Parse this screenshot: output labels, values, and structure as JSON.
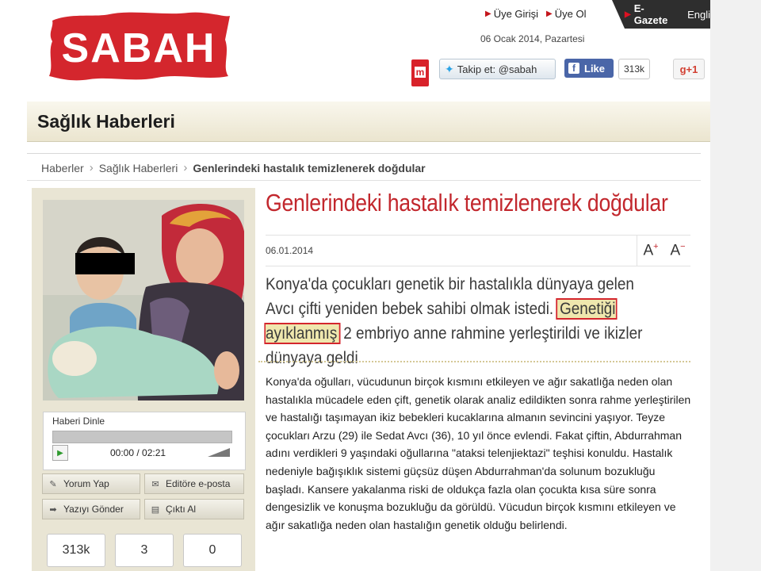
{
  "brand": {
    "name": "SABAH",
    "colors": {
      "red": "#d4262d",
      "dark": "#2e2e2e"
    }
  },
  "top_links": [
    {
      "label": "Üye Girişi"
    },
    {
      "label": "Üye Ol"
    }
  ],
  "egazete": {
    "label": "E-Gazete",
    "lang": "Engli"
  },
  "date": "06 Ocak 2014, Pazartesi",
  "social": {
    "mi_label": "m",
    "twitter_label": "Takip et: @sabah",
    "facebook_label": "Like",
    "facebook_count": "313k",
    "gplus_label": "g+1"
  },
  "section_title": "Sağlık Haberleri",
  "breadcrumb": [
    "Haberler",
    "Sağlık Haberleri",
    "Genlerindeki hastalık temizlenerek doğdular"
  ],
  "player": {
    "label": "Haberi Dinle",
    "time": "00:00 / 02:21"
  },
  "actions": [
    {
      "label": "Yorum Yap",
      "icon": "pencil-icon"
    },
    {
      "label": "Editöre e-posta",
      "icon": "envelope-icon"
    },
    {
      "label": "Yazıyı Gönder",
      "icon": "send-arrow-icon"
    },
    {
      "label": "Çıktı Al",
      "icon": "printer-icon"
    }
  ],
  "counts": [
    "313k",
    "3",
    "0"
  ],
  "article": {
    "title": "Genlerindeki hastalık temizlenerek doğdular",
    "date": "06.01.2014",
    "font_inc": "A",
    "font_dec": "A",
    "lead_before": "Konya'da çocukları genetik bir hastalıkla dünyaya gelen Avcı çifti yeniden bebek sahibi olmak istedi. ",
    "lead_highlight": "Genetiği ayıklanmış",
    "lead_after": " 2 embriyo anne rahmine yerleştirildi ve ikizler dünyaya geldi",
    "body": "Konya'da oğulları, vücudunun birçok kısmını etkileyen ve ağır sakatlığa neden olan hastalıkla mücadele eden çift, genetik olarak analiz edildikten sonra rahme yerleştirilen ve hastalığı taşımayan ikiz bebekleri kucaklarına almanın sevincini yaşıyor. Teyze çocukları Arzu (29) ile Sedat Avcı (36), 10 yıl önce evlendi. Fakat çiftin, Abdurrahman adını verdikleri 9 yaşındaki oğullarına \"ataksi telenjiektazi\" teşhisi konuldu. Hastalık nedeniyle bağışıklık sistemi güçsüz düşen Abdurrahman'da solunum bozukluğu başladı. Kansere yakalanma riski de oldukça fazla olan çocukta kısa süre sonra dengesizlik ve konuşma bozukluğu da görüldü. Vücudun birçok kısmını etkileyen ve ağır sakatlığa neden olan hastalığın genetik olduğu belirlendi."
  }
}
